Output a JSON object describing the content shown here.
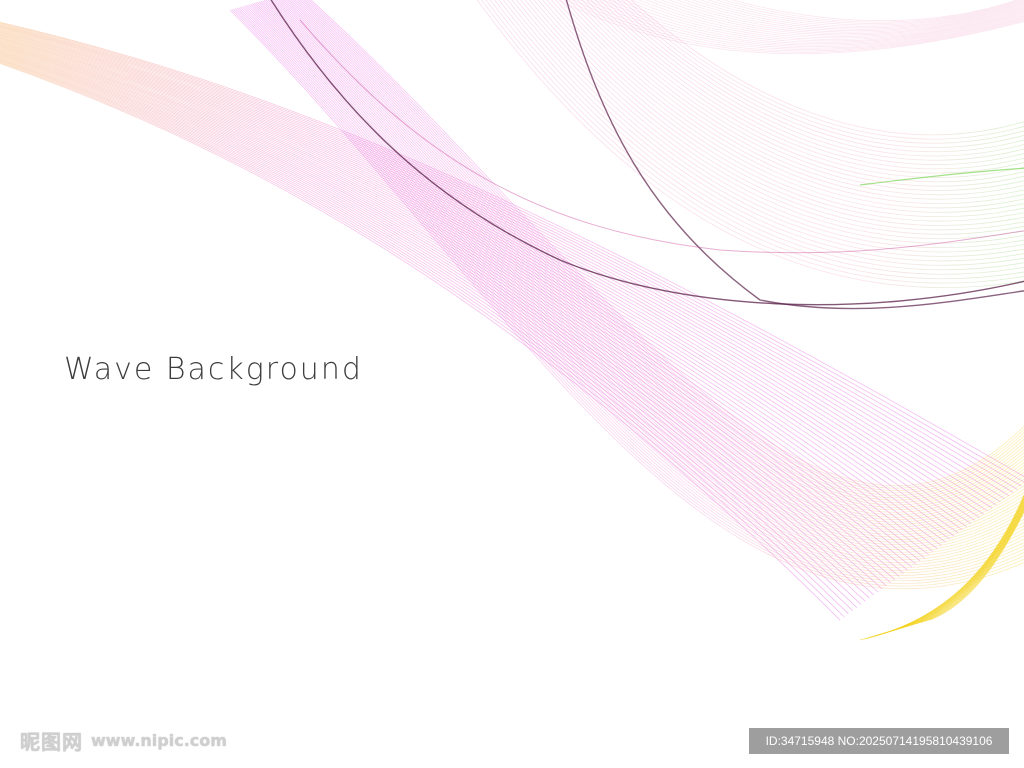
{
  "title": "Wave Background",
  "watermark": {
    "site_name_cn": "昵图网",
    "site_url": "www.nipic.com",
    "id_text": "ID:34715948 NO:20250714195810439106"
  },
  "colors": {
    "orange": "#f4a24a",
    "magenta": "#e13be0",
    "pink": "#f08ac8",
    "yellow": "#f4d21a",
    "green": "#7ed45a",
    "dark_line": "#5a1f48",
    "text": "#3d3d3d"
  }
}
